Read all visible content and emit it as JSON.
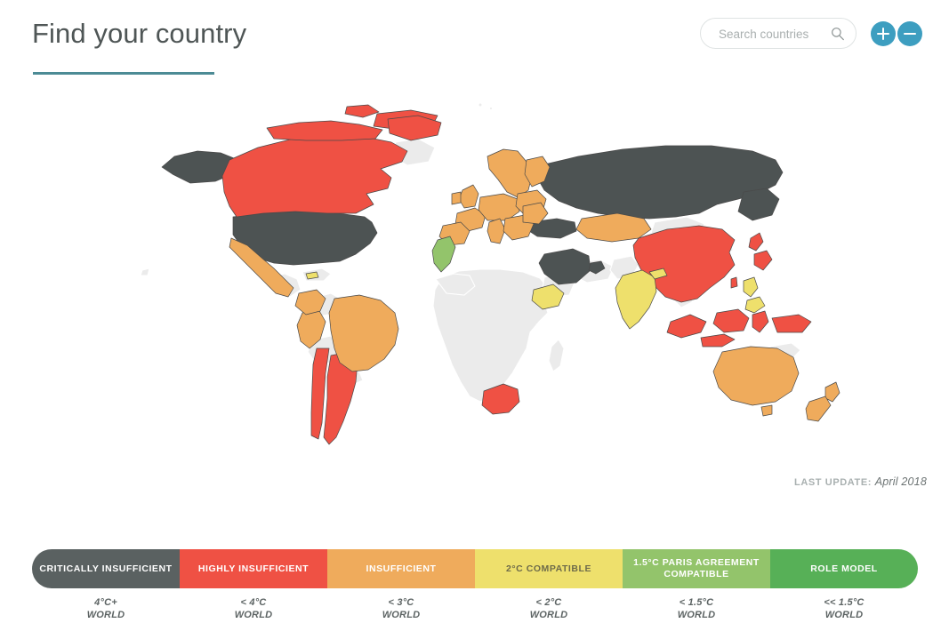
{
  "header": {
    "title": "Find your country",
    "underline_color": "#4c8b95"
  },
  "search": {
    "placeholder": "Search countries",
    "value": "",
    "icon": "search-icon"
  },
  "controls": {
    "zoom_in_label": "+",
    "zoom_in_icon": "plus-icon",
    "zoom_out_label": "−",
    "zoom_out_icon": "minus-icon",
    "button_color": "#3d9ec0"
  },
  "map": {
    "last_update_label": "LAST UPDATE:",
    "last_update_value": "April 2018",
    "no_data_color": "#ebebeb",
    "border_color": "#4a4a4a",
    "ocean_color": "#ffffff",
    "ratings": {
      "critically_insufficient": [
        "United States",
        "Russia",
        "Turkey",
        "Saudi Arabia",
        "United Arab Emirates"
      ],
      "highly_insufficient": [
        "Canada",
        "Argentina",
        "Chile",
        "China",
        "Japan",
        "Indonesia",
        "South Africa"
      ],
      "insufficient": [
        "Mexico",
        "Brazil",
        "Peru",
        "Colombia",
        "Kazakhstan",
        "European Union",
        "Norway",
        "Switzerland",
        "Australia",
        "New Zealand"
      ],
      "two_degree_compatible": [
        "India",
        "Philippines",
        "Ethiopia",
        "Bhutan"
      ],
      "paris_agreement_compatible": [
        "Morocco"
      ],
      "role_model": []
    }
  },
  "legend": {
    "items": [
      {
        "label": "CRITICALLY INSUFFICIENT",
        "temp": "4°C+",
        "world": "WORLD",
        "color": "#5a6161",
        "text_color": "#ffffff"
      },
      {
        "label": "HIGHLY INSUFFICIENT",
        "temp": "< 4°C",
        "world": "WORLD",
        "color": "#ef5144",
        "text_color": "#ffffff"
      },
      {
        "label": "INSUFFICIENT",
        "temp": "< 3°C",
        "world": "WORLD",
        "color": "#efab5c",
        "text_color": "#ffffff"
      },
      {
        "label": "2°C COMPATIBLE",
        "temp": "< 2°C",
        "world": "WORLD",
        "color": "#eee06c",
        "text_color": "#6e6b4a"
      },
      {
        "label": "1.5°C PARIS AGREEMENT COMPATIBLE",
        "temp": "< 1.5°C",
        "world": "WORLD",
        "color": "#93c46b",
        "text_color": "#ffffff"
      },
      {
        "label": "ROLE MODEL",
        "temp": "<< 1.5°C",
        "world": "WORLD",
        "color": "#57b057",
        "text_color": "#ffffff"
      }
    ]
  }
}
